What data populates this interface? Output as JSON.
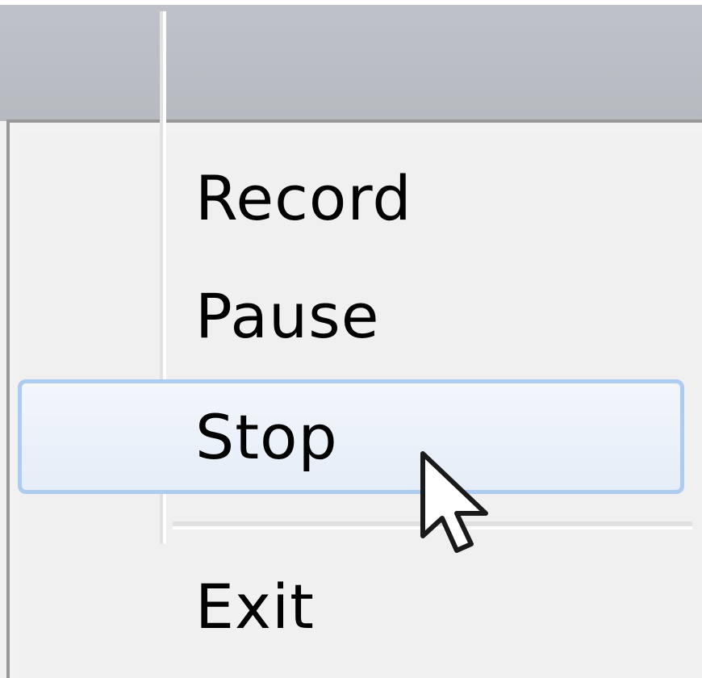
{
  "menu": {
    "items": [
      {
        "label": "Record"
      },
      {
        "label": "Pause"
      },
      {
        "label": "Stop",
        "highlighted": true
      },
      {
        "label": "Exit"
      }
    ]
  },
  "colors": {
    "highlight_border": "#aecbf0",
    "menu_background": "#f0f0f0",
    "title_bar": "#bcc0c5"
  },
  "icons": {
    "cursor": "arrow-cursor-icon"
  }
}
